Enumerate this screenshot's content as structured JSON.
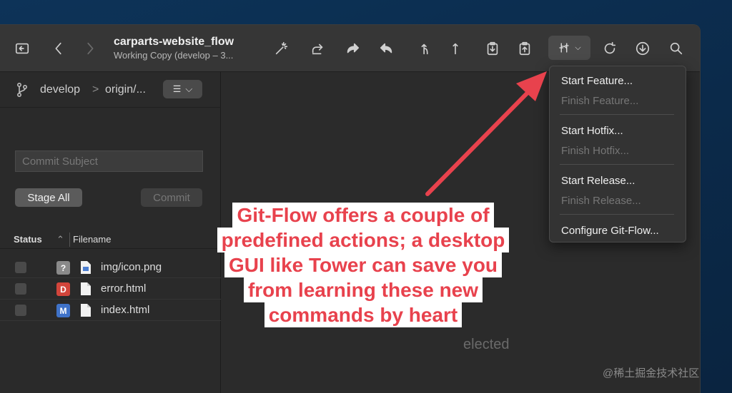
{
  "window": {
    "repo_title": "carparts-website_flow",
    "repo_subtitle": "Working Copy (develop – 3..."
  },
  "toolbar": {
    "icons": [
      "open-folder-icon",
      "back-icon",
      "forward-icon",
      "magic-wand-icon",
      "fetch-icon",
      "pull-icon",
      "push-icon",
      "branch-icon",
      "merge-icon",
      "stash-icon",
      "pop-stash-icon",
      "git-flow-icon",
      "refresh-icon",
      "download-icon",
      "search-icon"
    ]
  },
  "sidebar": {
    "branch": "develop",
    "separator": ">",
    "remote": "origin/...",
    "commit_placeholder": "Commit Subject",
    "stage_all_label": "Stage All",
    "commit_label": "Commit",
    "columns": {
      "status": "Status",
      "filename": "Filename"
    },
    "files": [
      {
        "badge": "?",
        "badge_color": "#8a8a8a",
        "name": "img/icon.png"
      },
      {
        "badge": "D",
        "badge_color": "#d2453b",
        "name": "error.html"
      },
      {
        "badge": "M",
        "badge_color": "#3f72c8",
        "name": "index.html"
      }
    ]
  },
  "main": {
    "empty_text": "elected"
  },
  "gitflow_menu": {
    "items": [
      {
        "label": "Start Feature...",
        "enabled": true
      },
      {
        "label": "Finish Feature...",
        "enabled": false
      },
      {
        "label": "Start Hotfix...",
        "enabled": true
      },
      {
        "label": "Finish Hotfix...",
        "enabled": false
      },
      {
        "label": "Start Release...",
        "enabled": true
      },
      {
        "label": "Finish Release...",
        "enabled": false
      },
      {
        "label": "Configure Git-Flow...",
        "enabled": true
      }
    ]
  },
  "annotation": {
    "lines": [
      "Git-Flow offers  a couple of",
      "predefined actions; a desktop",
      "GUI like Tower can save you",
      "from learning these new",
      "commands by heart"
    ],
    "color": "#e8424d"
  },
  "watermark": "@稀土掘金技术社区"
}
